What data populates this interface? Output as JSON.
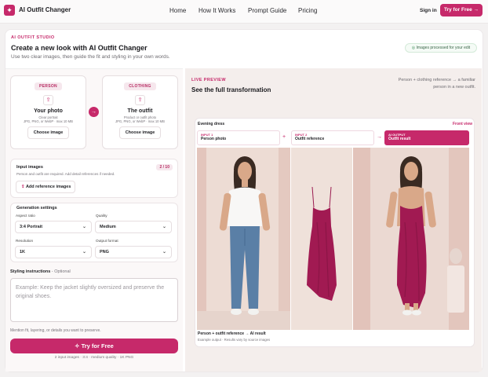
{
  "nav": {
    "brand": "AI Outfit Changer",
    "links": [
      "Home",
      "How It Works",
      "Prompt Guide",
      "Pricing"
    ],
    "signin": "Sign in",
    "cta": "Try for Free"
  },
  "header": {
    "eyebrow": "AI OUTFIT STUDIO",
    "title": "Create a new look with AI Outfit Changer",
    "subtitle": "Use two clear images, then guide the fit and styling in your own words.",
    "badge": "Images processed for your edit"
  },
  "person": {
    "chip": "PERSON",
    "title": "Your photo",
    "desc1": "Clear portrait",
    "desc2": "JPG, PNG, or WebP · max 10 MB",
    "button": "Choose image"
  },
  "clothing": {
    "chip": "CLOTHING",
    "title": "The outfit",
    "desc1": "Product or outfit photo",
    "desc2": "JPG, PNG, or WebP · max 10 MB",
    "button": "Choose image"
  },
  "inputs": {
    "title": "Input images",
    "count": "2 / 10",
    "desc": "Person and outfit are required. Add detail references if needed.",
    "button": "Add reference images"
  },
  "settings": {
    "title": "Generation settings",
    "aspect_label": "Aspect ratio",
    "aspect": "3:4 Portrait",
    "quality_label": "Quality",
    "quality": "Medium",
    "resolution_label": "Resolution",
    "resolution": "1K",
    "format_label": "Output format",
    "format": "PNG"
  },
  "styling": {
    "label": "Styling instructions",
    "optional": "Optional",
    "placeholder": "Example: Keep the jacket slightly oversized and preserve the original shoes.",
    "hint": "Mention fit, layering, or details you want to preserve."
  },
  "cta": {
    "label": "Try for Free",
    "note": "2 input images · 3:4 · medium quality · 1K PNG"
  },
  "preview": {
    "eyebrow": "LIVE PREVIEW",
    "title": "See the full transformation",
    "desc": "Person + clothing reference → a familiar person in a new outfit.",
    "card_title": "Evening dress",
    "view": "Front view",
    "step1_a": "INPUT 1",
    "step1_b": "Person photo",
    "step2_a": "INPUT 2",
    "step2_b": "Outfit reference",
    "step3_a": "AI OUTPUT",
    "step3_b": "Outfit result",
    "caption": "Person + outfit reference → AI result",
    "caption_sub": "Example output · Results vary by source images"
  },
  "colors": {
    "accent": "#c6296a",
    "dress": "#a11a52"
  }
}
